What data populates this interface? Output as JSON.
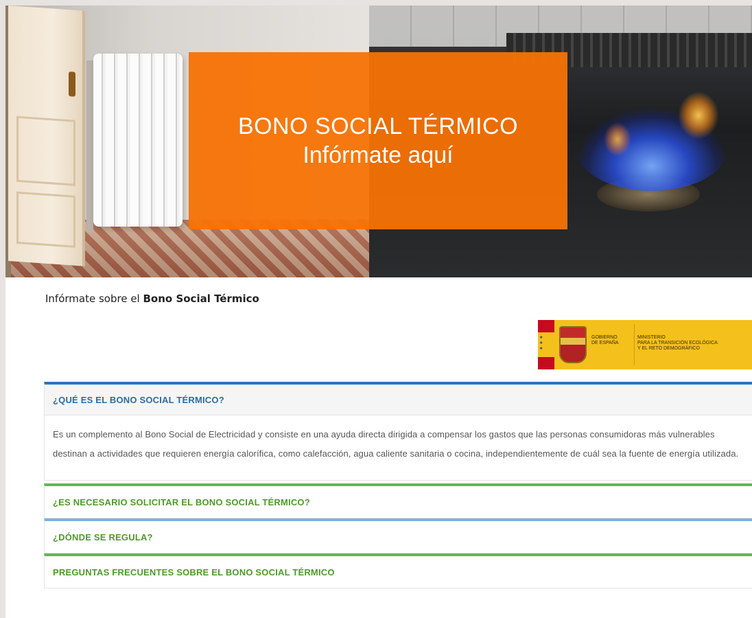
{
  "hero": {
    "title": "BONO SOCIAL TÉRMICO",
    "subtitle": "Infórmate aquí"
  },
  "intro": {
    "prefix": "Infórmate sobre el ",
    "bold": "Bono Social Térmico"
  },
  "logo": {
    "line1": "GOBIERNO",
    "line2": "DE ESPAÑA",
    "ministry1": "MINISTERIO",
    "ministry2": "PARA LA TRANSICIÓN ECOLÓGICA",
    "ministry3": "Y EL RETO DEMOGRÁFICO"
  },
  "accordion": [
    {
      "title": "¿QUÉ ES EL BONO SOCIAL TÉRMICO?",
      "body": "Es un complemento al Bono Social de Electricidad y consiste en una ayuda directa dirigida a compensar los gastos que las personas consumidoras más vulnerables destinan a actividades que requieren energía calorífica, como calefacción, agua caliente sanitaria o cocina, independientemente de cuál sea la fuente de energía utilizada.",
      "expanded": true,
      "accent": "#2d73b8"
    },
    {
      "title": "¿ES NECESARIO SOLICITAR EL BONO SOCIAL TÉRMICO?",
      "expanded": false,
      "accent": "#5cb85c"
    },
    {
      "title": "¿DÓNDE SE REGULA?",
      "expanded": false,
      "accent": "#7fb2e0"
    },
    {
      "title": "PREGUNTAS FRECUENTES SOBRE EL BONO SOCIAL TÉRMICO",
      "expanded": false,
      "accent": "#5cb85c"
    }
  ],
  "colors": {
    "banner_orange": "#f77204",
    "header_blue": "#2d6aa5",
    "header_green": "#4e9a2a"
  }
}
